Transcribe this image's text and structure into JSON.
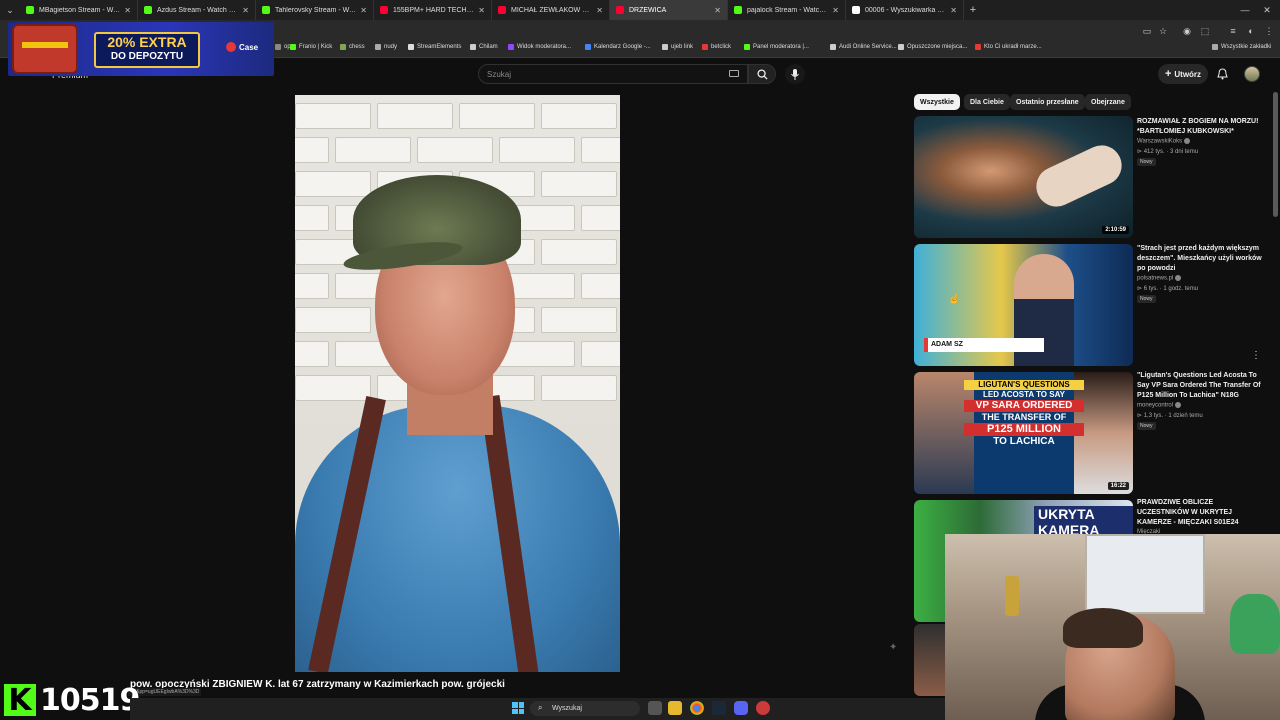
{
  "browser": {
    "tabs": [
      {
        "title": "MBagietson Stream - Watch Live",
        "favicon_color": "#53fc18"
      },
      {
        "title": "Azdus Stream - Watch Live on",
        "favicon_color": "#53fc18"
      },
      {
        "title": "Tahlerovsky Stream - Watch Li",
        "favicon_color": "#53fc18"
      },
      {
        "title": "155BPM+ HARD TECHNO & N",
        "favicon_color": "#ff0033"
      },
      {
        "title": "MICHAŁ ŻEWŁAKOW podaje p",
        "favicon_color": "#ff0033"
      },
      {
        "title": "DRZEWICA",
        "favicon_color": "#ff0033",
        "active": true
      },
      {
        "title": "pajalock Stream - Watch Live o",
        "favicon_color": "#53fc18"
      },
      {
        "title": "00006 - Wyszukiwarka Google",
        "favicon_color": "#ffffff"
      }
    ],
    "bookmarks": [
      {
        "label": "op",
        "color": "#888"
      },
      {
        "label": "Franio | Kick",
        "color": "#53fc18"
      },
      {
        "label": "chess",
        "color": "#7fa650"
      },
      {
        "label": "nudy",
        "color": "#aaa"
      },
      {
        "label": "StreamElements",
        "color": "#ddd"
      },
      {
        "label": "Chilam",
        "color": "#ccc"
      },
      {
        "label": "Widok moderatora...",
        "color": "#9146ff"
      },
      {
        "label": "Kalendarz Google -...",
        "color": "#4285f4"
      },
      {
        "label": "ujeb link",
        "color": "#ccc"
      },
      {
        "label": "betclick",
        "color": "#e53935"
      },
      {
        "label": "Panel moderatora |...",
        "color": "#53fc18"
      },
      {
        "label": "Audi Online Service...",
        "color": "#ccc"
      },
      {
        "label": "Opuszczone miejsca...",
        "color": "#ccc"
      },
      {
        "label": "Kto Ci ukradł marze...",
        "color": "#e53935"
      }
    ],
    "all_bookmarks_label": "Wszystkie zakładki"
  },
  "ad": {
    "line1": "20% EXTRA",
    "line2": "DO DEPOZYTU",
    "brand": "Case"
  },
  "youtube": {
    "premium_label": "Premium",
    "search_placeholder": "Szukaj",
    "create_label": "Utwórz",
    "chips": [
      "Wszystkie",
      "Dla Ciebie",
      "Ostatnio przesłane",
      "Obejrzane"
    ],
    "active_chip": 0,
    "recommendations": [
      {
        "title": "ROZMAWIAŁ Z BOGIEM NA MORZU! *BARTŁOMIEJ KUBKOWSKI*",
        "channel": "WarszawskiKoks",
        "meta": "412 tys. · 3 dni temu",
        "badge": "Nowy",
        "duration": "2:10:59"
      },
      {
        "title": "\"Strach jest przed każdym większym deszczem\". Mieszkańcy użyli worków po powodzi",
        "channel": "polsatnews.pl",
        "meta": "6 tys. · 1 godz. temu",
        "badge": "Nowy",
        "duration": ""
      },
      {
        "title": "\"Ligutan's Questions Led Acosta To Say VP Sara Ordered The Transfer Of P125 Million To Lachica\" N18G",
        "channel": "moneycontrol",
        "meta": "1,3 tys. · 1 dzień temu",
        "badge": "Nowy",
        "duration": "16:22"
      },
      {
        "title": "PRAWDZIWE OBLICZE UCZESTNIKÓW W UKRYTEJ KAMERZE - MIĘCZAKI S01E24",
        "channel": "Mięczaki",
        "meta": "",
        "badge": "",
        "duration": ""
      }
    ],
    "thumb3_text": [
      "LIGUTAN'S QUESTIONS",
      "LED ACOSTA TO SAY",
      "VP SARA ORDERED",
      "THE TRANSFER OF",
      "P125 MILLION",
      "TO LACHICA"
    ],
    "thumb2_lower_third": "ADAM SZ",
    "thumb4_text": "UKRYTA KAMERA"
  },
  "overlay": {
    "kick_count": "10519",
    "ticker": "pow. opoczyński ZBIGNIEW K. lat 67 zatrzymany w Kazimierkach pow. grójecki",
    "status_url": "4Y&pp=ugUEEgIwbA%3D%3D"
  },
  "taskbar": {
    "search_label": "Wyszukaj"
  },
  "colors": {
    "accent_red": "#ff0033",
    "kick_green": "#53fc18"
  }
}
